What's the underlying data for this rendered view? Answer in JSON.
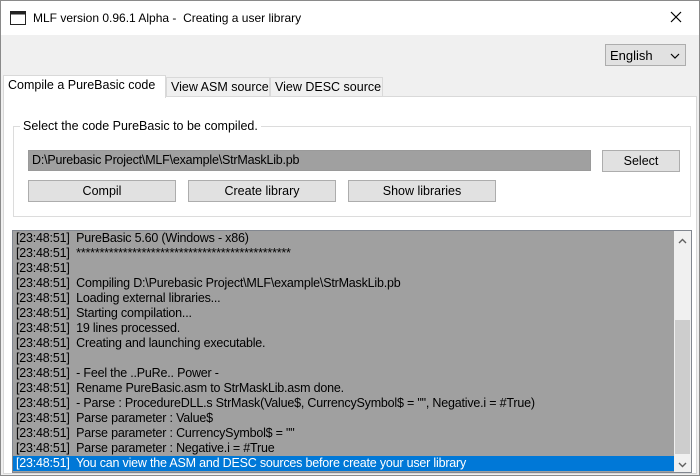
{
  "window": {
    "title": "MLF version 0.96.1 Alpha -  Creating a user library",
    "app_icon": "window-app-icon",
    "close_icon": "close-icon"
  },
  "language": {
    "selected": "English",
    "icon": "chevron-down-icon"
  },
  "tabs": [
    {
      "label": "Compile a PureBasic code",
      "active": true
    },
    {
      "label": "View ASM source",
      "active": false
    },
    {
      "label": "View DESC source",
      "active": false
    }
  ],
  "compile": {
    "group_label": "Select the code PureBasic to be compiled.",
    "file_path": "D:\\Purebasic Project\\MLF\\example\\StrMaskLib.pb",
    "select_label": "Select",
    "compil_label": "Compil",
    "create_library_label": "Create library",
    "show_libraries_label": "Show libraries"
  },
  "log": [
    {
      "time": "[23:48:51]",
      "text": "PureBasic 5.60 (Windows - x86)"
    },
    {
      "time": "[23:48:51]",
      "text": "**********************************************"
    },
    {
      "time": "[23:48:51]",
      "text": ""
    },
    {
      "time": "[23:48:51]",
      "text": "Compiling D:\\Purebasic Project\\MLF\\example\\StrMaskLib.pb"
    },
    {
      "time": "[23:48:51]",
      "text": "Loading external libraries..."
    },
    {
      "time": "[23:48:51]",
      "text": "Starting compilation..."
    },
    {
      "time": "[23:48:51]",
      "text": "19 lines processed."
    },
    {
      "time": "[23:48:51]",
      "text": "Creating and launching executable."
    },
    {
      "time": "[23:48:51]",
      "text": ""
    },
    {
      "time": "[23:48:51]",
      "text": "- Feel the ..PuRe.. Power -"
    },
    {
      "time": "[23:48:51]",
      "text": "Rename PureBasic.asm to StrMaskLib.asm done."
    },
    {
      "time": "[23:48:51]",
      "text": "- Parse : ProcedureDLL.s StrMask(Value$, CurrencySymbol$ = \"\", Negative.i = #True)"
    },
    {
      "time": "[23:48:51]",
      "text": "Parse parameter : Value$"
    },
    {
      "time": "[23:48:51]",
      "text": "Parse parameter : CurrencySymbol$ = \"\""
    },
    {
      "time": "[23:48:51]",
      "text": "Parse parameter : Negative.i = #True"
    },
    {
      "time": "[23:48:51]",
      "text": "You can view the ASM and DESC sources before create your user library",
      "selected": true
    }
  ],
  "scrollbar": {
    "up_icon": "scroll-up-icon",
    "down_icon": "scroll-down-icon"
  },
  "colors": {
    "log_background": "#a0a0a0",
    "selection": "#0078d7"
  }
}
